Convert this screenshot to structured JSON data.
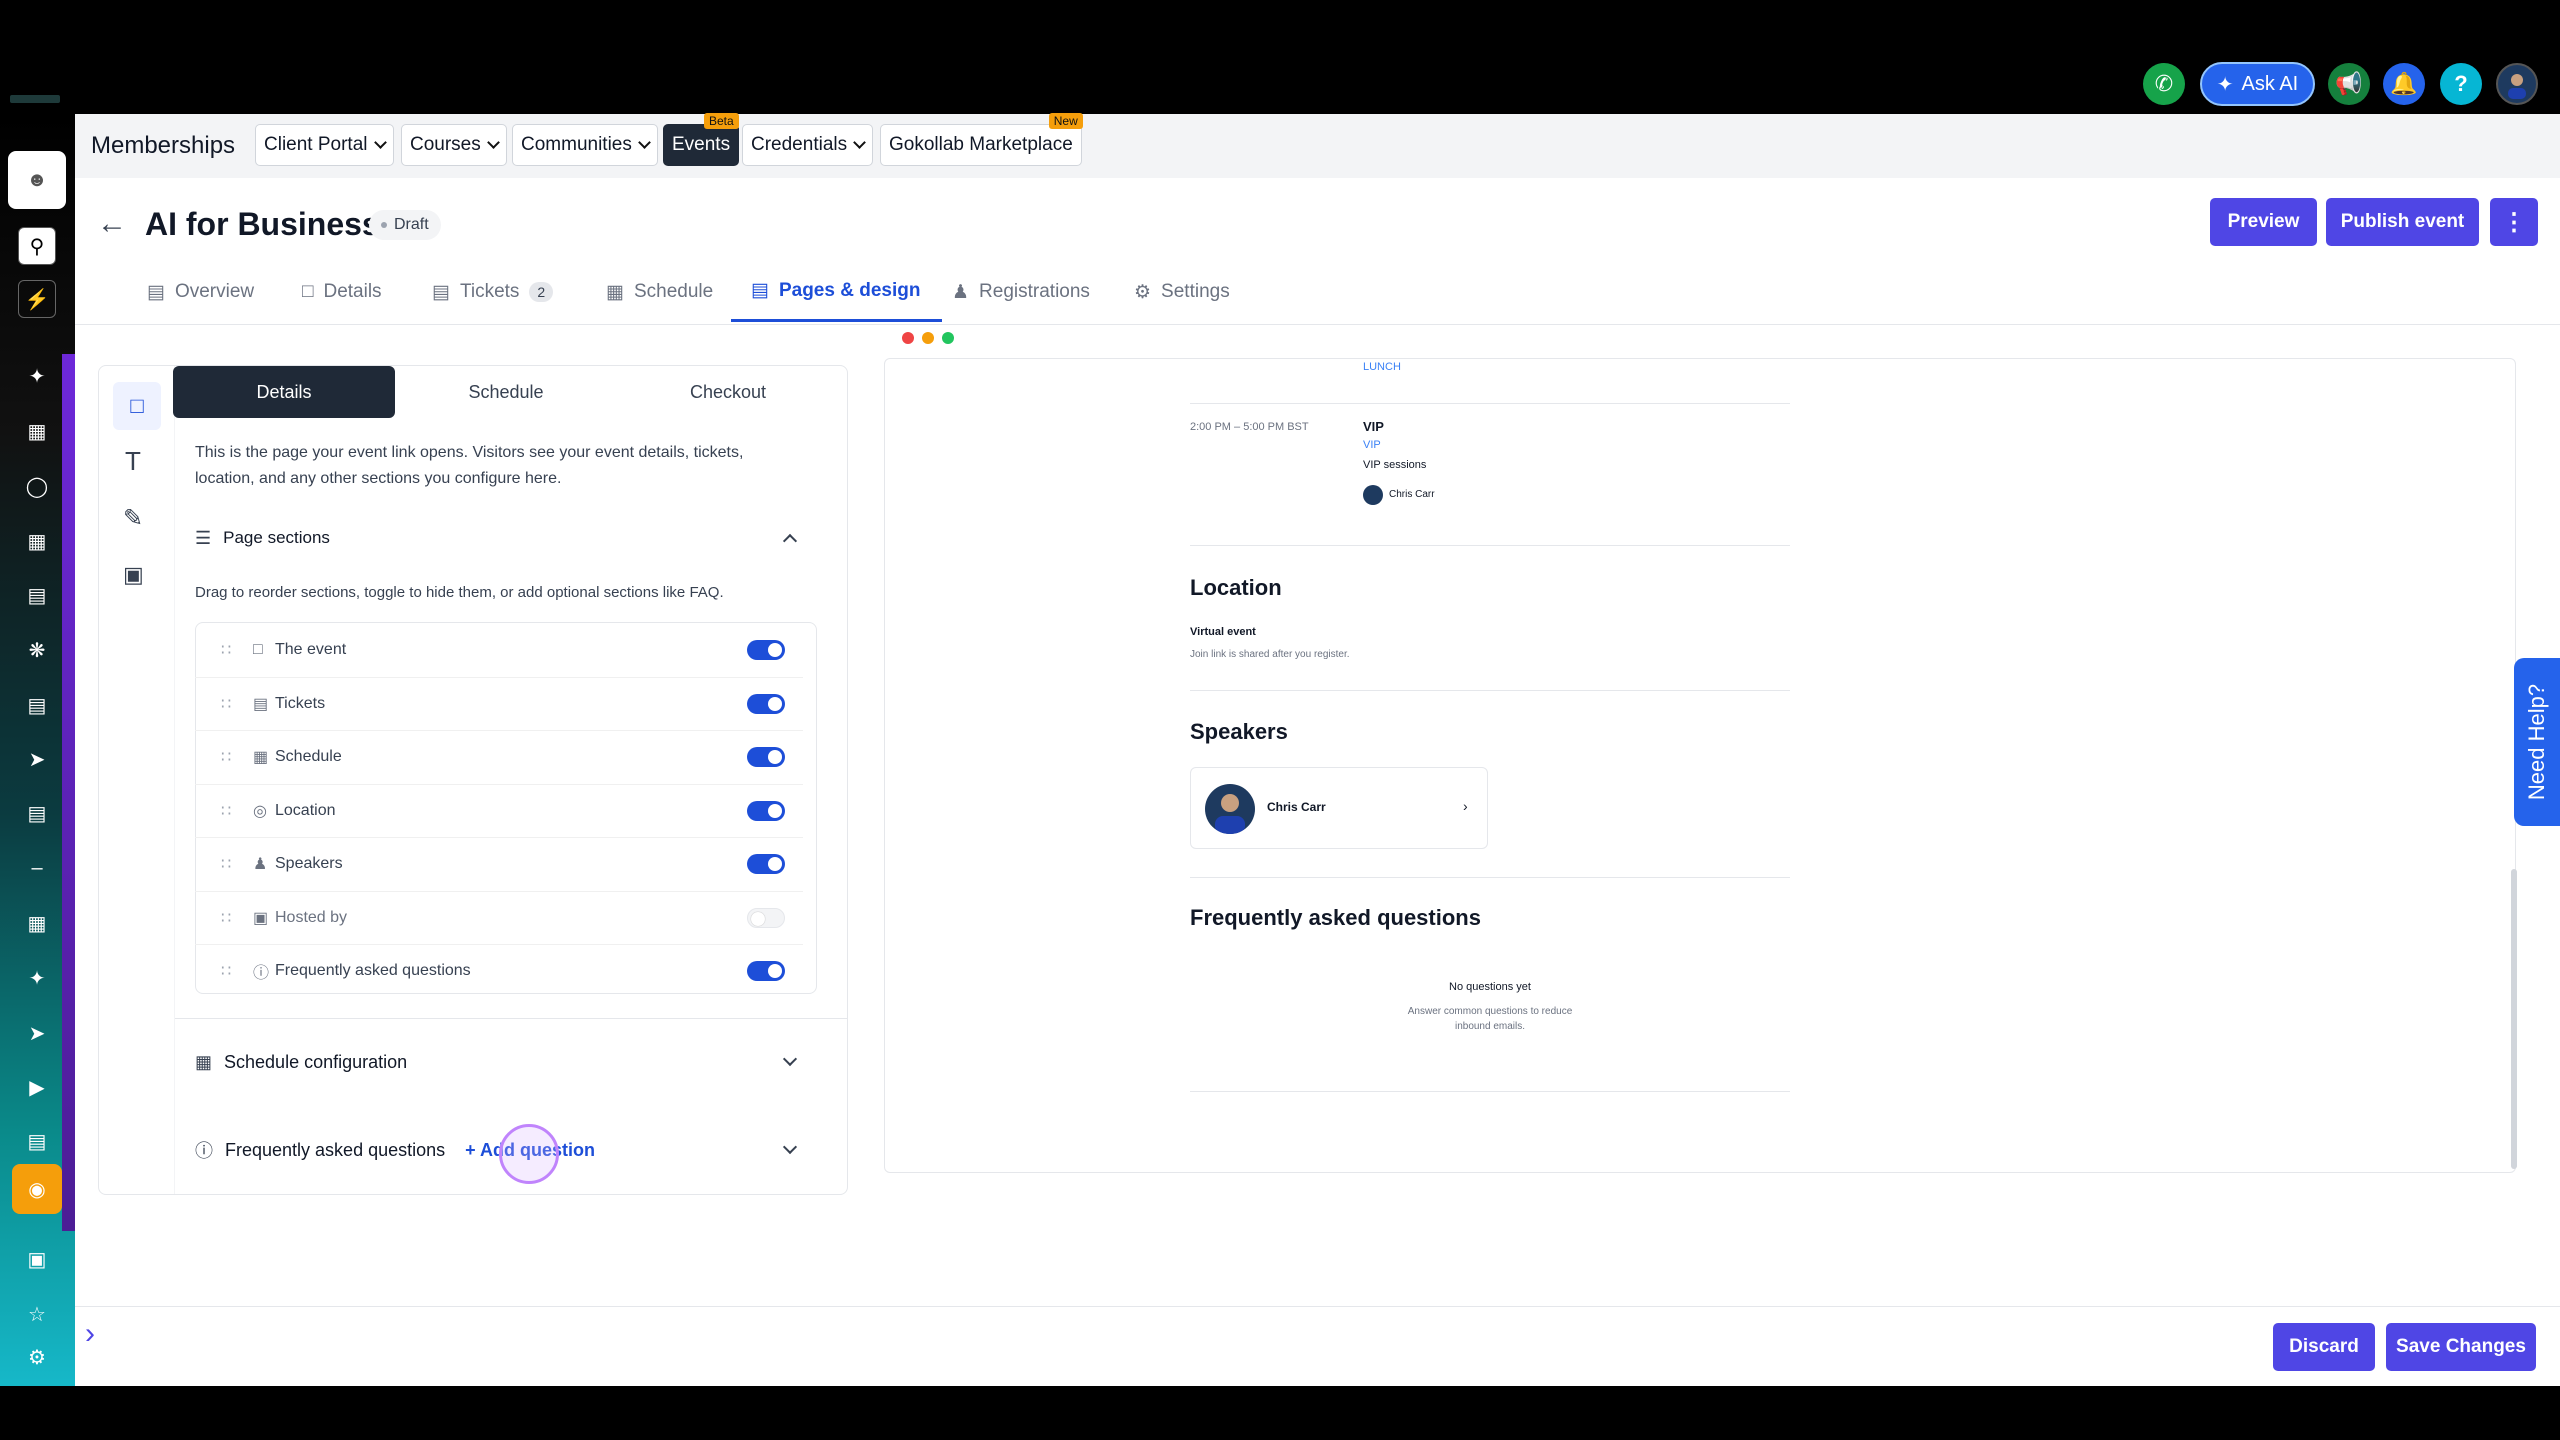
{
  "topbar": {
    "ask_ai_label": "Ask AI",
    "help_label": "?",
    "icons": [
      "phone-icon",
      "sparkle-icon",
      "megaphone-icon",
      "bell-icon",
      "help-icon",
      "user-avatar"
    ]
  },
  "nav": {
    "title": "Memberships",
    "items": [
      {
        "label": "Client Portal",
        "dropdown": true
      },
      {
        "label": "Courses",
        "dropdown": true
      },
      {
        "label": "Communities",
        "dropdown": true
      },
      {
        "label": "Events",
        "badge": "Beta",
        "active": true
      },
      {
        "label": "Credentials",
        "dropdown": true
      },
      {
        "label": "Gokollab Marketplace",
        "badge": "New"
      }
    ]
  },
  "header": {
    "title": "AI for Business",
    "status": "Draft",
    "preview_label": "Preview",
    "publish_label": "Publish event"
  },
  "tabs": [
    {
      "label": "Overview",
      "icon": "layout-icon"
    },
    {
      "label": "Details",
      "icon": "document-icon"
    },
    {
      "label": "Tickets",
      "icon": "ticket-icon",
      "count": "2"
    },
    {
      "label": "Schedule",
      "icon": "calendar-icon"
    },
    {
      "label": "Pages & design",
      "icon": "layout-icon",
      "active": true
    },
    {
      "label": "Registrations",
      "icon": "users-icon"
    },
    {
      "label": "Settings",
      "icon": "gear-icon"
    }
  ],
  "panel": {
    "segments": [
      "Details",
      "Schedule",
      "Checkout"
    ],
    "description": "This is the page your event link opens. Visitors see your event details, tickets, location, and any other sections you configure here.",
    "page_sections_label": "Page sections",
    "sections_hint": "Drag to reorder sections, toggle to hide them, or add optional sections like FAQ.",
    "sections": [
      {
        "label": "The event",
        "icon": "document-icon",
        "enabled": true
      },
      {
        "label": "Tickets",
        "icon": "ticket-icon",
        "enabled": true
      },
      {
        "label": "Schedule",
        "icon": "calendar-icon",
        "enabled": true
      },
      {
        "label": "Location",
        "icon": "location-pin-icon",
        "enabled": true
      },
      {
        "label": "Speakers",
        "icon": "users-icon",
        "enabled": true
      },
      {
        "label": "Hosted by",
        "icon": "building-icon",
        "enabled": false
      },
      {
        "label": "Frequently asked questions",
        "icon": "question-circle-icon",
        "enabled": true
      }
    ],
    "schedule_config_label": "Schedule configuration",
    "faq_label": "Frequently asked questions",
    "add_question_label": "+ Add question"
  },
  "preview": {
    "lunch_tag": "LUNCH",
    "vip_time": "2:00 PM – 5:00 PM BST",
    "vip_title": "VIP",
    "vip_tag": "VIP",
    "vip_desc": "VIP sessions",
    "vip_speaker": "Chris Carr",
    "location_heading": "Location",
    "location_type": "Virtual event",
    "location_note": "Join link is shared after you register.",
    "speakers_heading": "Speakers",
    "speaker_name": "Chris Carr",
    "faq_heading": "Frequently asked questions",
    "faq_empty": "No questions yet",
    "faq_empty_note": "Answer common questions to reduce inbound emails."
  },
  "footer": {
    "discard_label": "Discard",
    "save_label": "Save Changes"
  },
  "need_help_label": "Need Help?"
}
